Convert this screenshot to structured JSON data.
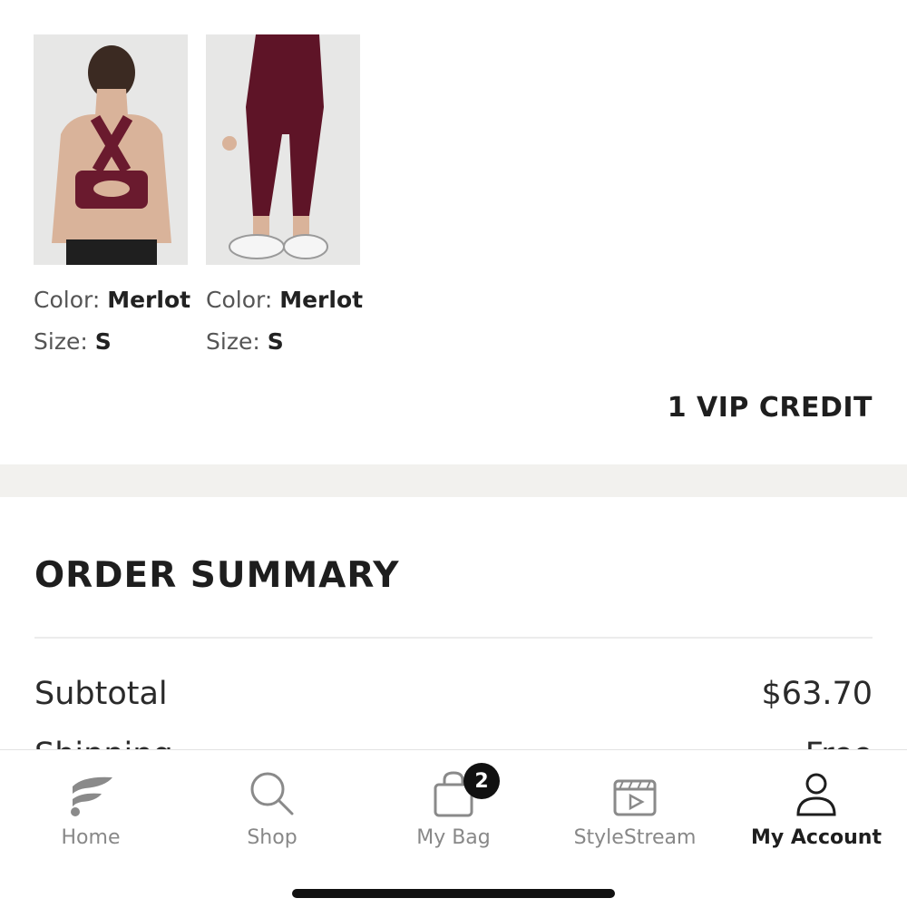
{
  "products": [
    {
      "color_label": "Color:",
      "color_value": "Merlot",
      "size_label": "Size:",
      "size_value": "S"
    },
    {
      "color_label": "Color:",
      "color_value": "Merlot",
      "size_label": "Size:",
      "size_value": "S"
    }
  ],
  "price_credit": "1 VIP CREDIT",
  "summary": {
    "title": "ORDER SUMMARY",
    "subtotal_label": "Subtotal",
    "subtotal_value": "$63.70",
    "next_row_label": "Shipping",
    "next_row_value": "Free"
  },
  "tabs": {
    "home": "Home",
    "shop": "Shop",
    "bag": "My Bag",
    "bag_count": "2",
    "stylestream": "StyleStream",
    "account": "My Account"
  },
  "colors": {
    "product": "#6a1a2e",
    "active_tab": "#1e1e1e",
    "inactive_tab": "#888888"
  }
}
